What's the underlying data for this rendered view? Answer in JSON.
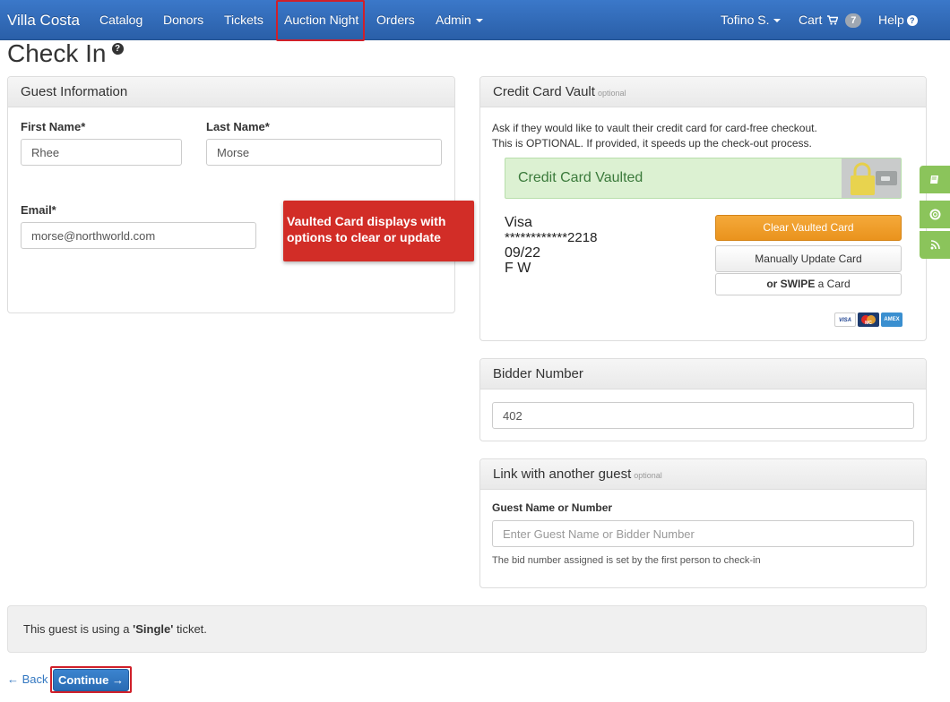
{
  "nav": {
    "brand": "Villa Costa",
    "items": [
      "Catalog",
      "Donors",
      "Tickets",
      "Auction Night",
      "Orders",
      "Admin"
    ],
    "user": "Tofino S.",
    "cart_label": "Cart",
    "cart_count": "7",
    "help_label": "Help",
    "help_icon_glyph": "?"
  },
  "page": {
    "title": "Check In",
    "help_glyph": "?"
  },
  "guest": {
    "heading": "Guest Information",
    "first_name_label": "First Name*",
    "first_name_value": "Rhee",
    "last_name_label": "Last Name*",
    "last_name_value": "Morse",
    "email_label": "Email*",
    "email_value": "morse@northworld.com"
  },
  "callout": {
    "line1": "Vaulted Card displays with",
    "line2": "options to clear or update"
  },
  "vault": {
    "heading": "Credit Card Vault",
    "optional": "optional",
    "desc_line1": "Ask if they would like to vault their credit card for card-free checkout.",
    "desc_line2": "This is OPTIONAL. If provided, it speeds up the check-out process.",
    "status": "Credit Card Vaulted",
    "card_type": "Visa",
    "card_number": "************2218",
    "expiry": "09/22",
    "initials": "F W",
    "clear_button": "Clear Vaulted Card",
    "update_button": "Manually Update Card",
    "swipe_bold": "or SWIPE",
    "swipe_rest": " a Card",
    "card_logos": [
      "VISA",
      "MC",
      "AMEX"
    ]
  },
  "bidder": {
    "heading": "Bidder Number",
    "value": "402"
  },
  "link_guest": {
    "heading": "Link with another guest",
    "optional": "optional",
    "field_label": "Guest Name or Number",
    "placeholder": "Enter Guest Name or Bidder Number",
    "help_text": "The bid number assigned is set by the first person to check-in"
  },
  "ticket_info": {
    "prefix": "This guest is using a ",
    "ticket_name": "'Single'",
    "suffix": " ticket."
  },
  "footer": {
    "back_label": "← Back",
    "continue_label": "Continue →"
  },
  "side_tabs": [
    "book-icon",
    "lifebuoy-icon",
    "rss-icon"
  ],
  "colors": {
    "navbar": "#2e64ad",
    "highlight": "#d0202a",
    "vaulted_bg": "#dcf1d2",
    "clear_button": "#f0a02e",
    "continue_button": "#3478c1",
    "side_tabs": "#8bc45b"
  }
}
